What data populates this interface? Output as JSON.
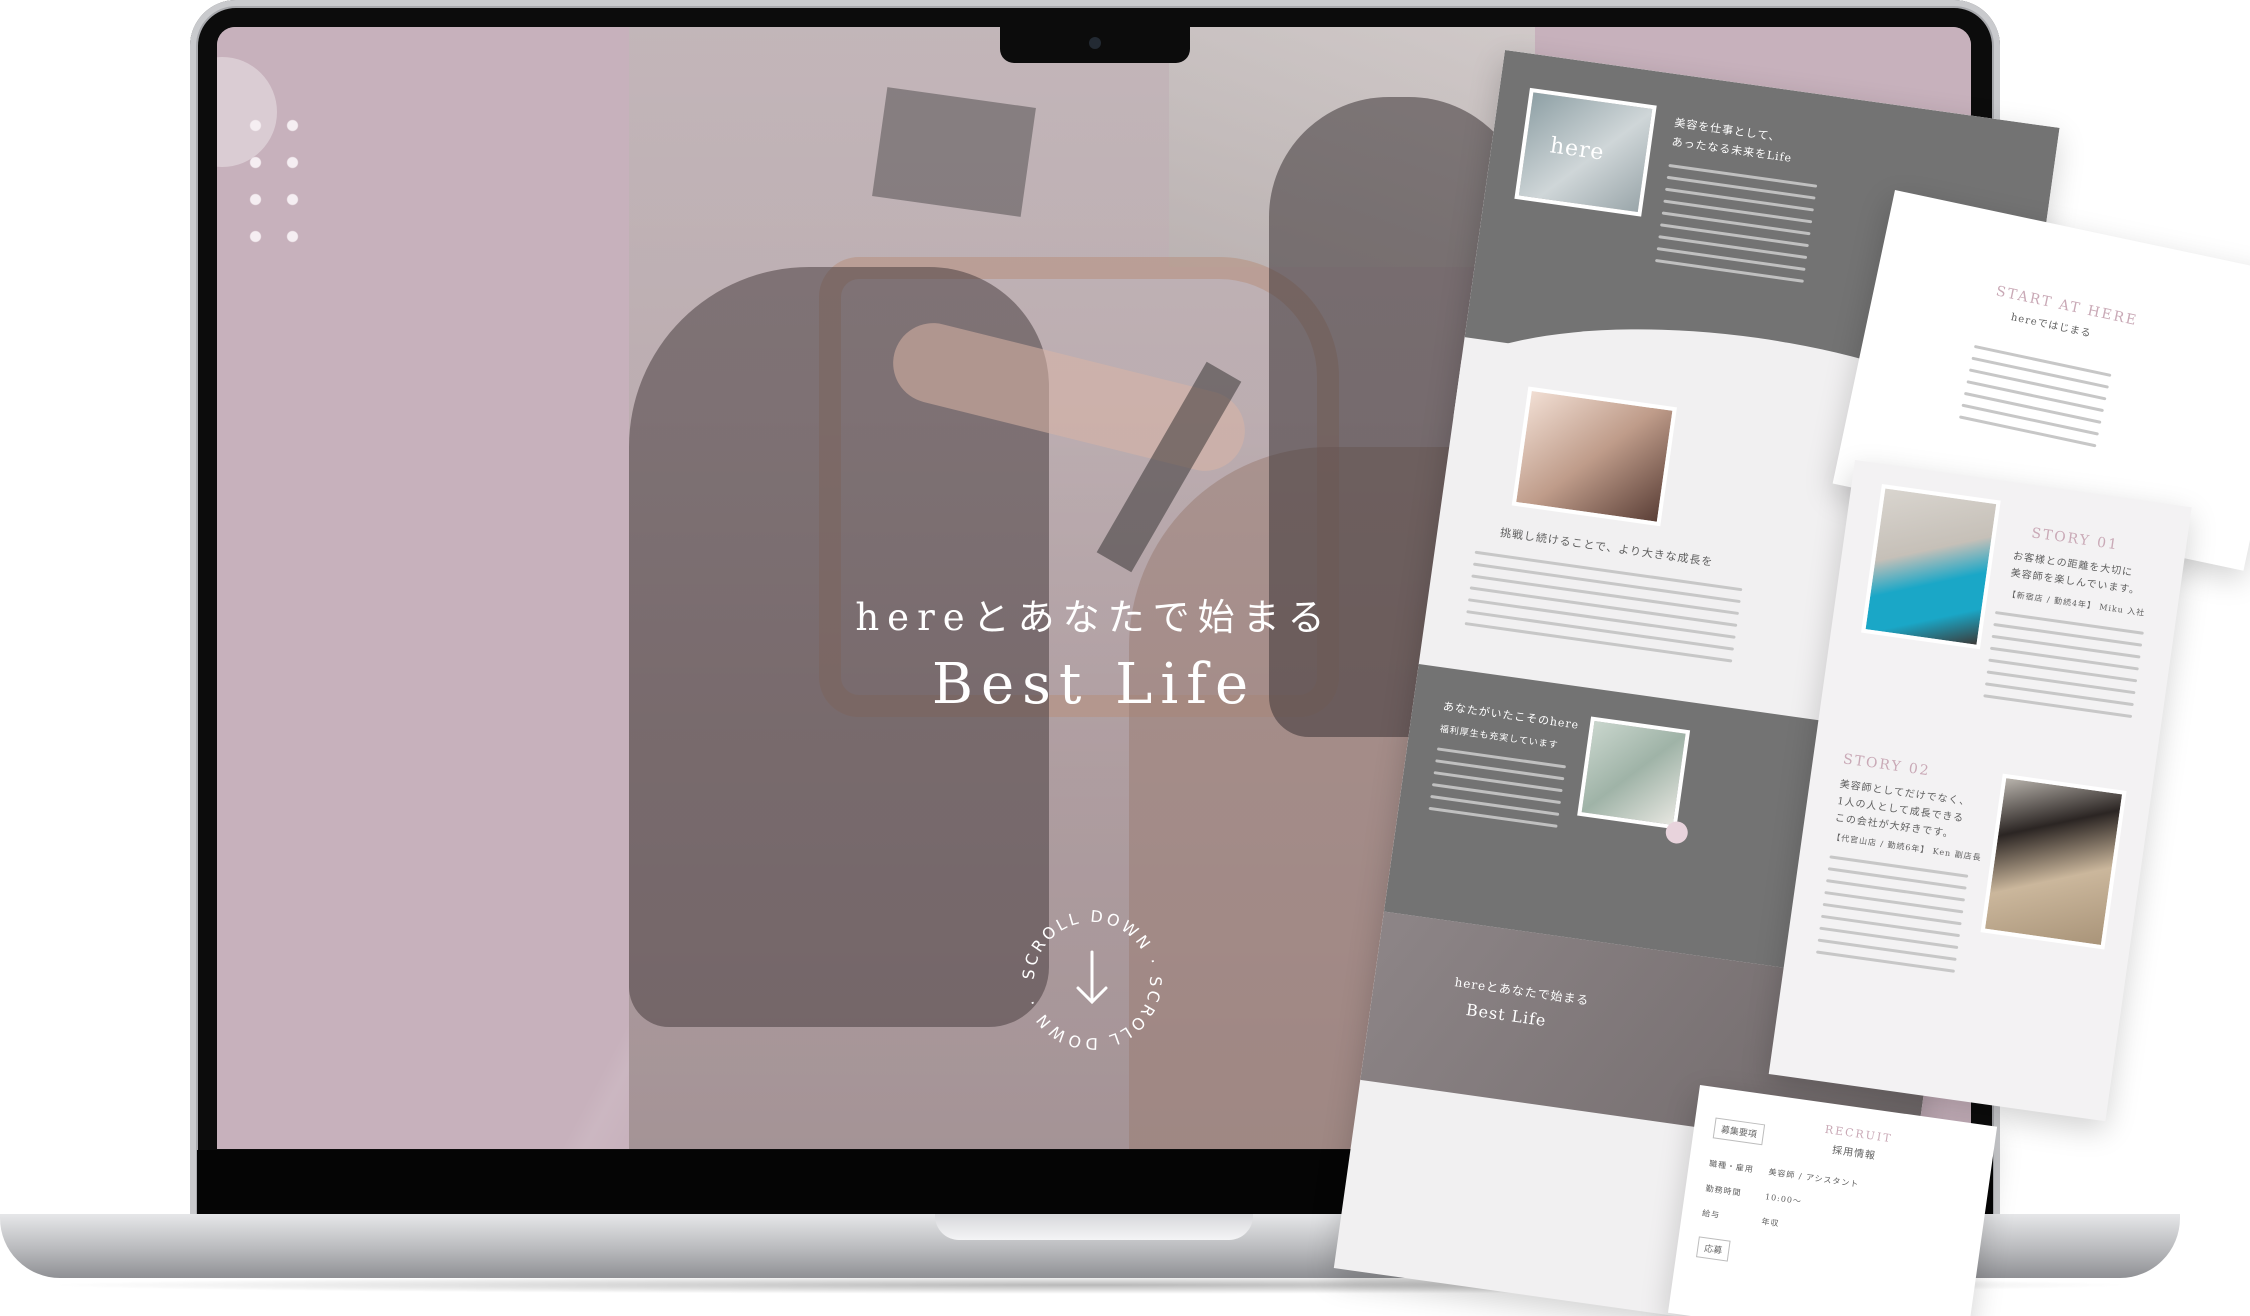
{
  "hero": {
    "subtitle": "hereとあなたで始まる",
    "title": "Best Life",
    "scroll_text": "SCROLL DOWN · SCROLL DOWN ·"
  },
  "mockup": {
    "logo": "here",
    "section1_heading": "美容を仕事として、\nあったなる未来をLife",
    "section2_heading": "挑戦し続けることで、より大きな成長を",
    "section3_heading": "あなたがいたこそのhere",
    "section3_sub": "福利厚生も充実しています",
    "footer_sub": "hereとあなたで始まる",
    "footer_title": "Best Life",
    "start_title": "START AT HERE",
    "start_sub": "hereではじまる",
    "story1_label": "STORY 01",
    "story1_heading": "お客様との距離を大切に\n美容師を楽しんでいます。",
    "story1_meta": "【新宿店 / 勤続4年】 Miku 入社",
    "story2_label": "STORY 02",
    "story2_heading": "美容師としてだけでなく、\n1人の人として成長できる\nこの会社が大好きです。",
    "story2_meta": "【代官山店 / 勤続6年】 Ken 副店長",
    "recruit_title": "RECRUIT",
    "recruit_sub": "採用情報",
    "recruit_tag1": "募集要項",
    "recruit_row1_label": "職種・雇用",
    "recruit_row1_value": "美容師 / アシスタント",
    "recruit_row2_label": "勤務時間",
    "recruit_row2_value": "10:00〜",
    "recruit_row3_label": "給与",
    "recruit_row3_value": "年収",
    "recruit_tag2": "応募"
  },
  "colors": {
    "screen_bg": "#c7b1bc",
    "mockup_gray": "#737373",
    "accent_rose": "#c9a9b6"
  }
}
